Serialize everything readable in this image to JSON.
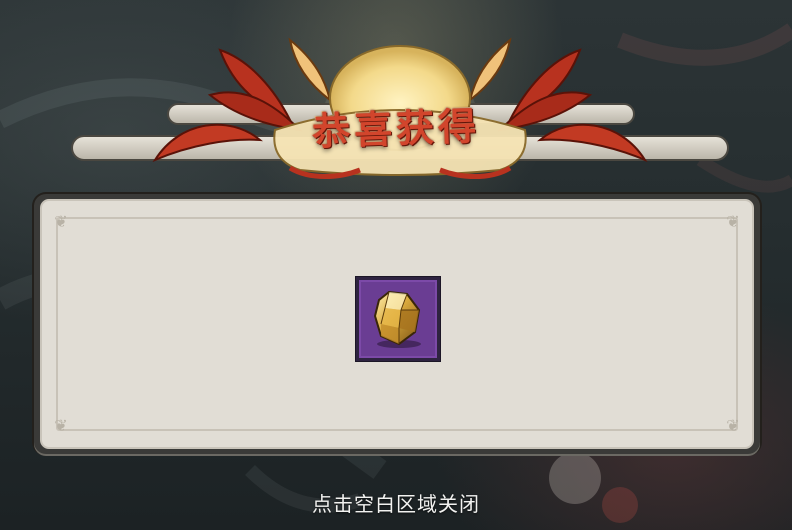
{
  "header": {
    "title": "恭喜获得"
  },
  "reward_panel": {
    "items": [
      {
        "icon": "gold-ore-crystal-icon",
        "rarity_color": "#6a3d93"
      }
    ]
  },
  "footer": {
    "close_hint": "点击空白区域关闭"
  },
  "colors": {
    "title_red": "#d2452c",
    "panel_bg": "#e1ddd5",
    "flame_red": "#b8321f",
    "sun_gold": "#f3d98a",
    "item_rarity_purple": "#6a3d93"
  }
}
